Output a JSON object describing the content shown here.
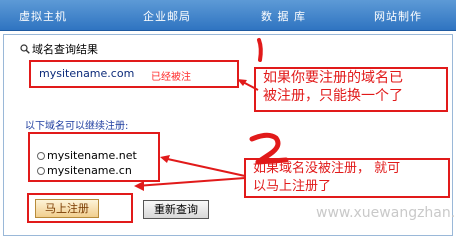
{
  "nav": {
    "items": [
      "虚拟主机",
      "企业邮局",
      "数 据 库",
      "网站制作"
    ]
  },
  "result": {
    "section_title": "域名查询结果",
    "domain": "mysitename.com",
    "status": "已经被注"
  },
  "annotations": {
    "note1": "如果你要注册的域名已被注册，只能换一个了",
    "note1_line1": "如果你要注册的域名已",
    "note1_line2": "被注册，只能换一个了",
    "note2_line1": "如果域名没被注册， 就可",
    "note2_line2": "以马上注册了"
  },
  "available": {
    "label": "以下域名可以继续注册:",
    "options": [
      "mysitename.net",
      "mysitename.cn"
    ]
  },
  "buttons": {
    "register": "马上注册",
    "requery": "重新查询"
  },
  "watermark": "www.xuewangzhan.net",
  "colors": {
    "nav_bg": "#2f74c1",
    "annotation_red": "#e11a1a",
    "domain_blue": "#0b2a7a"
  }
}
